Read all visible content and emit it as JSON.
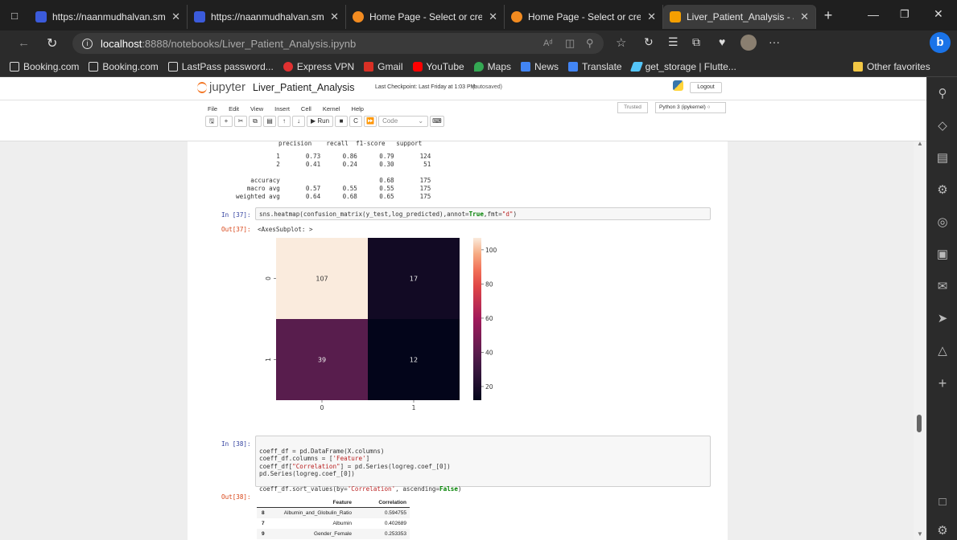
{
  "browser": {
    "tabs": [
      {
        "title": "https://naanmudhalvan.smarti",
        "fav": "#3b5bdb"
      },
      {
        "title": "https://naanmudhalvan.smarti",
        "fav": "#3b5bdb"
      },
      {
        "title": "Home Page - Select or create a",
        "fav": "#f28b20"
      },
      {
        "title": "Home Page - Select or create a",
        "fav": "#f28b20"
      },
      {
        "title": "Liver_Patient_Analysis - Jupyte",
        "fav": "#f59f00"
      }
    ],
    "url_host": "localhost",
    "url_path": ":8888/notebooks/Liver_Patient_Analysis.ipynb",
    "bookmarks": [
      {
        "label": "Booking.com",
        "color": "#ddd"
      },
      {
        "label": "Booking.com",
        "color": "#ddd"
      },
      {
        "label": "LastPass password...",
        "color": "#ddd"
      },
      {
        "label": "Express VPN",
        "color": "#e03131"
      },
      {
        "label": "Gmail",
        "color": "#d93025"
      },
      {
        "label": "YouTube",
        "color": "#ff0000"
      },
      {
        "label": "Maps",
        "color": "#34a853"
      },
      {
        "label": "News",
        "color": "#4285f4"
      },
      {
        "label": "Translate",
        "color": "#4285f4"
      },
      {
        "label": "get_storage | Flutte...",
        "color": "#54c5f8"
      }
    ],
    "other_favorites": "Other favorites"
  },
  "jupyter": {
    "logo": "jupyter",
    "notebook_name": "Liver_Patient_Analysis",
    "checkpoint": "Last Checkpoint: Last Friday at 1:03 PM",
    "autosaved": "(autosaved)",
    "logout": "Logout",
    "menu": [
      "File",
      "Edit",
      "View",
      "Insert",
      "Cell",
      "Kernel",
      "Help"
    ],
    "trusted": "Trusted",
    "kernel": "Python 3 (ipykernel)",
    "run_label": "Run",
    "cell_type": "Code"
  },
  "report": {
    "header": "precision    recall  f1-score   support",
    "lines": [
      "           1       0.73      0.86      0.79       124",
      "           2       0.41      0.24      0.30        51",
      "",
      "    accuracy                           0.68       175",
      "   macro avg       0.57      0.55      0.55       175",
      "weighted avg       0.64      0.68      0.65       175"
    ]
  },
  "cell37": {
    "in": "In [37]:",
    "code": "sns.heatmap(confusion_matrix(y_test,log_predicted),annot=True,fmt=\"d\")",
    "out": "Out[37]:",
    "out_text": "<AxesSubplot: >"
  },
  "chart_data": {
    "type": "heatmap",
    "x_labels": [
      "0",
      "1"
    ],
    "y_labels": [
      "0",
      "1"
    ],
    "values": [
      [
        107,
        17
      ],
      [
        39,
        12
      ]
    ],
    "colorbar_ticks": [
      100,
      80,
      60,
      40,
      20
    ],
    "vmin": 12,
    "vmax": 107,
    "cmap": "rocket"
  },
  "cell38": {
    "in": "In [38]:",
    "code_lines": [
      "coeff_df = pd.DataFrame(X.columns)",
      "coeff_df.columns = ['Feature']",
      "coeff_df[\"Correlation\"] = pd.Series(logreg.coef_[0])",
      "pd.Series(logreg.coef_[0])",
      "",
      "coeff_df.sort_values(by='Correlation', ascending=False)"
    ],
    "out": "Out[38]:"
  },
  "table": {
    "columns": [
      "Feature",
      "Correlation"
    ],
    "rows": [
      {
        "idx": "8",
        "feature": "Albumin_and_Globulin_Ratio",
        "corr": "0.594755"
      },
      {
        "idx": "7",
        "feature": "Albumin",
        "corr": "0.402689"
      },
      {
        "idx": "9",
        "feature": "Gender_Female",
        "corr": "0.253353"
      }
    ]
  }
}
